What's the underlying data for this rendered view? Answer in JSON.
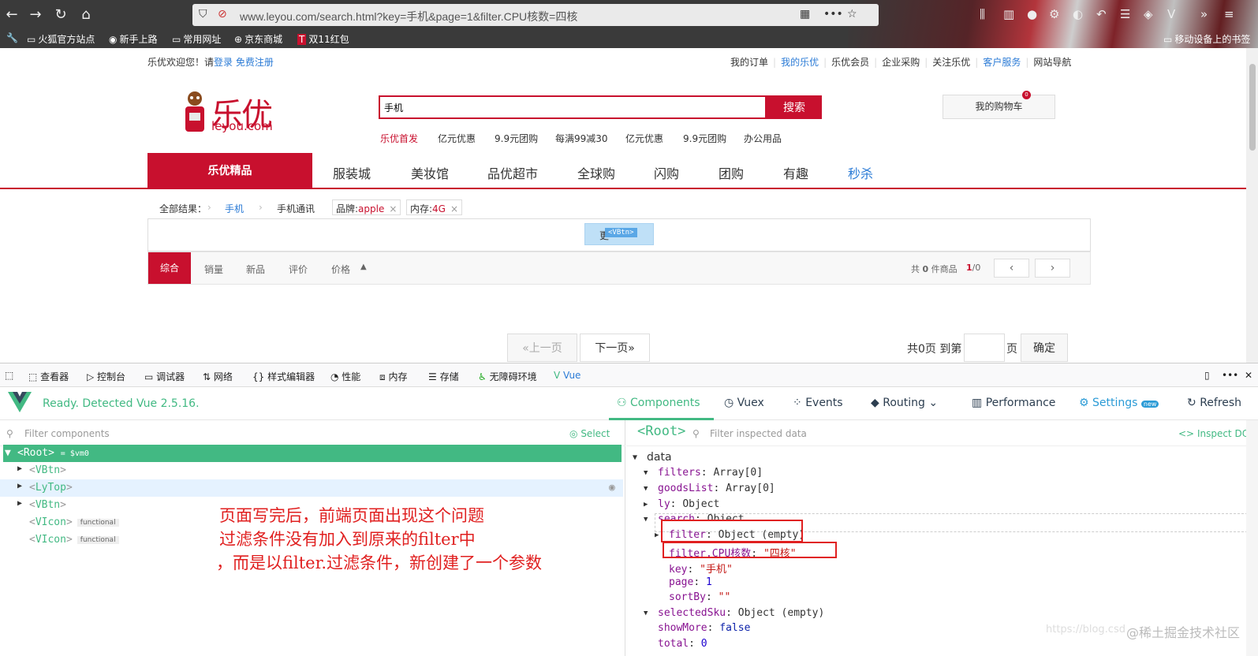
{
  "browser": {
    "url": "www.leyou.com/search.html?key=手机&page=1&filter.CPU核数=四核",
    "bookmarks": [
      "火狐官方站点",
      "新手上路",
      "常用网址",
      "京东商城",
      "双11红包"
    ],
    "mobile_bookmarks": "移动设备上的书签"
  },
  "site": {
    "welcome": "乐优欢迎您！请",
    "login": "登录",
    "register": "免费注册",
    "top_links": [
      "我的订单",
      "我的乐优",
      "乐优会员",
      "企业采购",
      "关注乐优",
      "客户服务",
      "网站导航"
    ],
    "logo_text": "乐优",
    "logo_domain": "leyou.com",
    "search_value": "手机",
    "search_button": "搜索",
    "hot_words": [
      "乐优首发",
      "亿元优惠",
      "9.9元团购",
      "每满99减30",
      "亿元优惠",
      "9.9元团购",
      "办公用品"
    ],
    "cart": "我的购物车",
    "nav": [
      "乐优精品",
      "服装城",
      "美妆馆",
      "品优超市",
      "全球购",
      "闪购",
      "团购",
      "有趣",
      "秒杀"
    ],
    "crumbs": [
      "全部结果：",
      "手机",
      "手机通讯"
    ],
    "tags": [
      {
        "k": "品牌:",
        "v": "apple"
      },
      {
        "k": "内存:",
        "v": "4G"
      }
    ],
    "vbtn_label": "<VBtn>",
    "vbtn_letter": "更",
    "sort": [
      "综合",
      "销量",
      "新品",
      "评价",
      "价格"
    ],
    "total_prefix": "共",
    "total_count": "0",
    "total_suffix": "件商品",
    "page_cur": "1",
    "page_tot": "/0",
    "prev_page": "«上一页",
    "next_page": "下一页»",
    "pages_total": "共0页 到第",
    "page_unit": "页",
    "confirm": "确定"
  },
  "devtools": {
    "tabs": [
      "查看器",
      "控制台",
      "调试器",
      "网络",
      "样式编辑器",
      "性能",
      "内存",
      "存储",
      "无障碍环境",
      "Vue"
    ],
    "vue_status": "Ready. Detected Vue 2.5.16.",
    "vue_tabs": [
      "Components",
      "Vuex",
      "Events",
      "Routing",
      "Performance",
      "Settings",
      "Refresh"
    ],
    "new_badge": "new",
    "filter_components": "Filter components",
    "select": "Select",
    "root_crumb": "<Root>",
    "filter_data": "Filter inspected data",
    "inspect_dom": "Inspect DOM",
    "tree": [
      {
        "name": "Root",
        "extra": "= $vm0"
      },
      {
        "name": "VBtn"
      },
      {
        "name": "LyTop"
      },
      {
        "name": "VBtn"
      },
      {
        "name": "VIcon",
        "badge": "functional"
      },
      {
        "name": "VIcon",
        "badge": "functional"
      }
    ],
    "annotation": [
      "页面写完后，前端页面出现这个问题",
      "过滤条件没有加入到原来的filter中",
      "，而是以filter.过滤条件，新创建了一个参数"
    ],
    "data_section": "data",
    "data": [
      {
        "k": "filters",
        "v": "Array[0]"
      },
      {
        "k": "goodsList",
        "v": "Array[0]"
      },
      {
        "k": "ly",
        "v": "Object"
      },
      {
        "k": "search",
        "v": "Object"
      },
      {
        "k": "filter",
        "v": "Object (empty)"
      },
      {
        "k": "filter.CPU核数",
        "v": "\"四核\""
      },
      {
        "k": "key",
        "v": "\"手机\""
      },
      {
        "k": "page",
        "v": "1"
      },
      {
        "k": "sortBy",
        "v": "\"\""
      },
      {
        "k": "selectedSku",
        "v": "Object (empty)"
      },
      {
        "k": "showMore",
        "v": "false"
      },
      {
        "k": "total",
        "v": "0"
      }
    ],
    "watermark": "https://blog.csd",
    "watermark2": "@稀土掘金技术社区"
  },
  "colors": {
    "brand_red": "#c8102e",
    "vue_green": "#42b983",
    "annot_red": "#e02020"
  }
}
